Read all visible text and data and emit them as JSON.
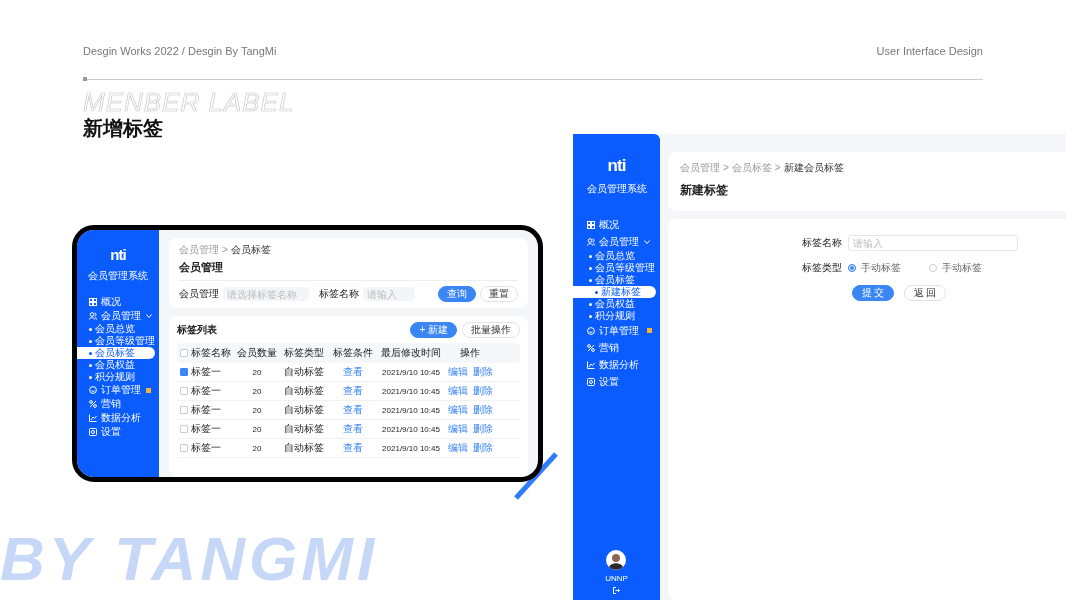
{
  "header": {
    "left": "Desgin Works 2022 / Desgin By TangMi",
    "right": "User Interface Design"
  },
  "heading": {
    "outline": "MENBER LABEL",
    "title": "新增标签"
  },
  "backdrop_text": "BY TANGMI",
  "list_screen": {
    "logo": "nti",
    "system_name": "会员管理系统",
    "nav": [
      {
        "label": "概况",
        "selected": false,
        "expanded": false,
        "dot": false
      },
      {
        "label": "会员管理",
        "selected": false,
        "expanded": true,
        "dot": false,
        "children": [
          {
            "label": "会员总览",
            "selected": false
          },
          {
            "label": "会员等级管理",
            "selected": false
          },
          {
            "label": "会员标签",
            "selected": true
          },
          {
            "label": "会员权益",
            "selected": false
          },
          {
            "label": "积分规则",
            "selected": false
          }
        ]
      },
      {
        "label": "订单管理",
        "selected": false,
        "expanded": false,
        "dot": true
      },
      {
        "label": "营销",
        "selected": false,
        "expanded": false,
        "dot": false
      },
      {
        "label": "数据分析",
        "selected": false,
        "expanded": false,
        "dot": false
      },
      {
        "label": "设置",
        "selected": false,
        "expanded": false,
        "dot": false
      }
    ],
    "breadcrumb": [
      {
        "label": "会员管理",
        "kind": "link"
      },
      {
        "label": ">",
        "kind": "separator"
      },
      {
        "label": "会员标签",
        "kind": "current"
      }
    ],
    "page_title": "会员管理",
    "filters": [
      {
        "label": "会员管理",
        "placeholder": "请选择标签名称"
      },
      {
        "label": "标签名称",
        "placeholder": "请输入"
      }
    ],
    "filter_buttons": [
      {
        "label": "查询",
        "kind": "primary"
      },
      {
        "label": "重置",
        "kind": "plain"
      }
    ],
    "list_title": "标签列表",
    "list_buttons": [
      {
        "label": "+ 新建",
        "kind": "primary"
      },
      {
        "label": "批量操作",
        "kind": "plain"
      }
    ],
    "all_checked": false,
    "columns": [
      "标签名称",
      "会员数量",
      "标签类型",
      "标签条件",
      "最后修改时间",
      "操作"
    ],
    "rows": [
      {
        "checked": true,
        "name": "标签一",
        "count": "20",
        "type": "自动标签",
        "condition": "查看",
        "time": "2021/9/10 10:45",
        "actions": [
          "编辑",
          "删除"
        ]
      },
      {
        "checked": false,
        "name": "标签一",
        "count": "20",
        "type": "自动标签",
        "condition": "查看",
        "time": "2021/9/10 10:45",
        "actions": [
          "编辑",
          "删除"
        ]
      },
      {
        "checked": false,
        "name": "标签一",
        "count": "20",
        "type": "自动标签",
        "condition": "查看",
        "time": "2021/9/10 10:45",
        "actions": [
          "编辑",
          "删除"
        ]
      },
      {
        "checked": false,
        "name": "标签一",
        "count": "20",
        "type": "自动标签",
        "condition": "查看",
        "time": "2021/9/10 10:45",
        "actions": [
          "编辑",
          "删除"
        ]
      },
      {
        "checked": false,
        "name": "标签一",
        "count": "20",
        "type": "自动标签",
        "condition": "查看",
        "time": "2021/9/10 10:45",
        "actions": [
          "编辑",
          "删除"
        ]
      }
    ]
  },
  "form_screen": {
    "logo": "nti",
    "system_name": "会员管理系统",
    "nav": [
      {
        "label": "概况",
        "selected": false,
        "expanded": false,
        "dot": false
      },
      {
        "label": "会员管理",
        "selected": false,
        "expanded": true,
        "dot": false,
        "children": [
          {
            "label": "会员总览",
            "selected": false
          },
          {
            "label": "会员等级管理",
            "selected": false
          },
          {
            "label": "会员标签",
            "selected": false,
            "children": [
              {
                "label": "新建标签",
                "selected": true
              }
            ]
          },
          {
            "label": "会员权益",
            "selected": false
          },
          {
            "label": "积分规则",
            "selected": false
          }
        ]
      },
      {
        "label": "订单管理",
        "selected": false,
        "expanded": false,
        "dot": true
      },
      {
        "label": "营销",
        "selected": false,
        "expanded": false,
        "dot": false
      },
      {
        "label": "数据分析",
        "selected": false,
        "expanded": false,
        "dot": false
      },
      {
        "label": "设置",
        "selected": false,
        "expanded": false,
        "dot": false
      }
    ],
    "user_name": "UNNP",
    "breadcrumb": [
      {
        "label": "会员管理",
        "kind": "link"
      },
      {
        "label": ">",
        "kind": "separator"
      },
      {
        "label": "会员标签",
        "kind": "link"
      },
      {
        "label": ">",
        "kind": "separator"
      },
      {
        "label": "新建会员标签",
        "kind": "current"
      }
    ],
    "page_title": "新建标签",
    "name_field": {
      "label": "标签名称",
      "placeholder": "请输入"
    },
    "type_field": {
      "label": "标签类型",
      "options": [
        {
          "label": "手动标签",
          "selected": true
        },
        {
          "label": "手动标签",
          "selected": false
        }
      ]
    },
    "buttons": [
      {
        "label": "提 交",
        "kind": "primary"
      },
      {
        "label": "返 回",
        "kind": "plain"
      }
    ]
  }
}
